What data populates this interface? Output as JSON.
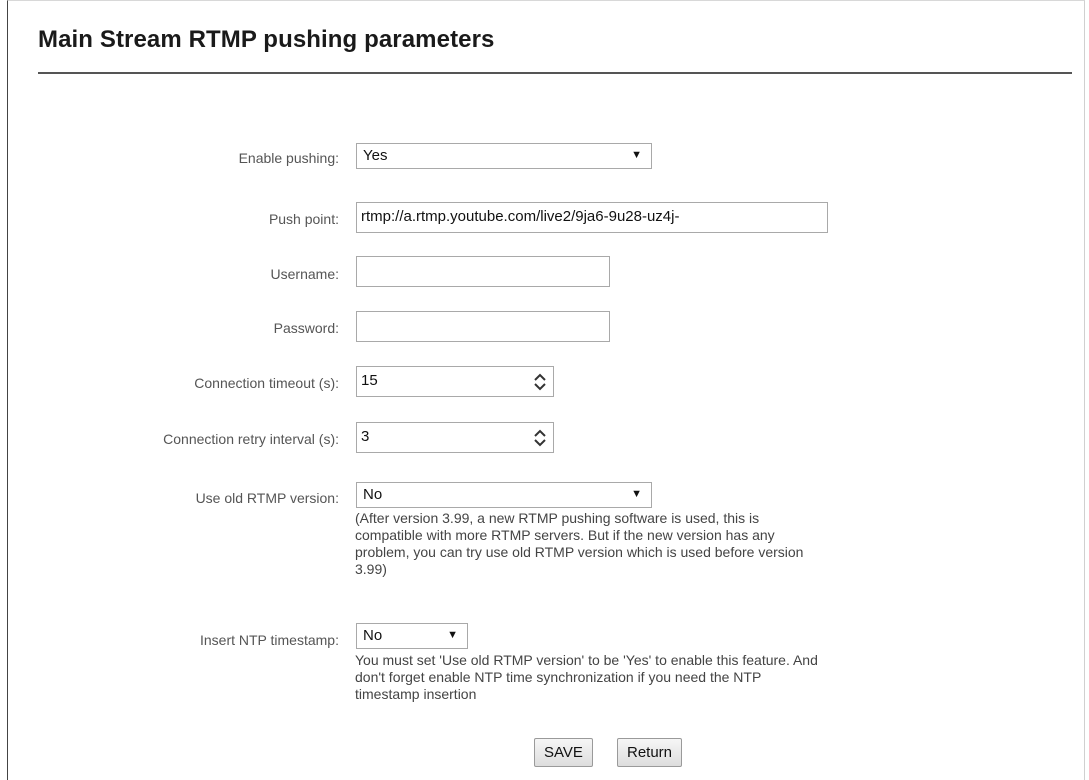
{
  "page": {
    "title": "Main Stream RTMP pushing parameters"
  },
  "form": {
    "enable_pushing": {
      "label": "Enable pushing:",
      "value": "Yes"
    },
    "push_point": {
      "label": "Push point:",
      "value": "rtmp://a.rtmp.youtube.com/live2/9ja6-9u28-uz4j-"
    },
    "username": {
      "label": "Username:",
      "value": ""
    },
    "password": {
      "label": "Password:",
      "value": ""
    },
    "connection_timeout": {
      "label": "Connection timeout (s):",
      "value": "15"
    },
    "retry_interval": {
      "label": "Connection retry interval (s):",
      "value": "3"
    },
    "old_rtmp": {
      "label": "Use old RTMP version:",
      "value": "No",
      "help": [
        "(After version 3.99, a new RTMP pushing software is used, this is",
        "compatible with more RTMP servers. But if the new version has any",
        "problem, you can try use old RTMP version which is used before version",
        "3.99)"
      ]
    },
    "ntp_timestamp": {
      "label": "Insert NTP timestamp:",
      "value": "No",
      "help": [
        "You must set 'Use old RTMP version' to be 'Yes' to enable this feature. And",
        "don't forget enable NTP time synchronization if you need the NTP",
        "timestamp insertion"
      ]
    }
  },
  "buttons": {
    "save": "SAVE",
    "return": "Return"
  },
  "icons": {
    "dropdown": "dropdown-arrow-icon",
    "spinner": "spinner-arrows-icon"
  }
}
